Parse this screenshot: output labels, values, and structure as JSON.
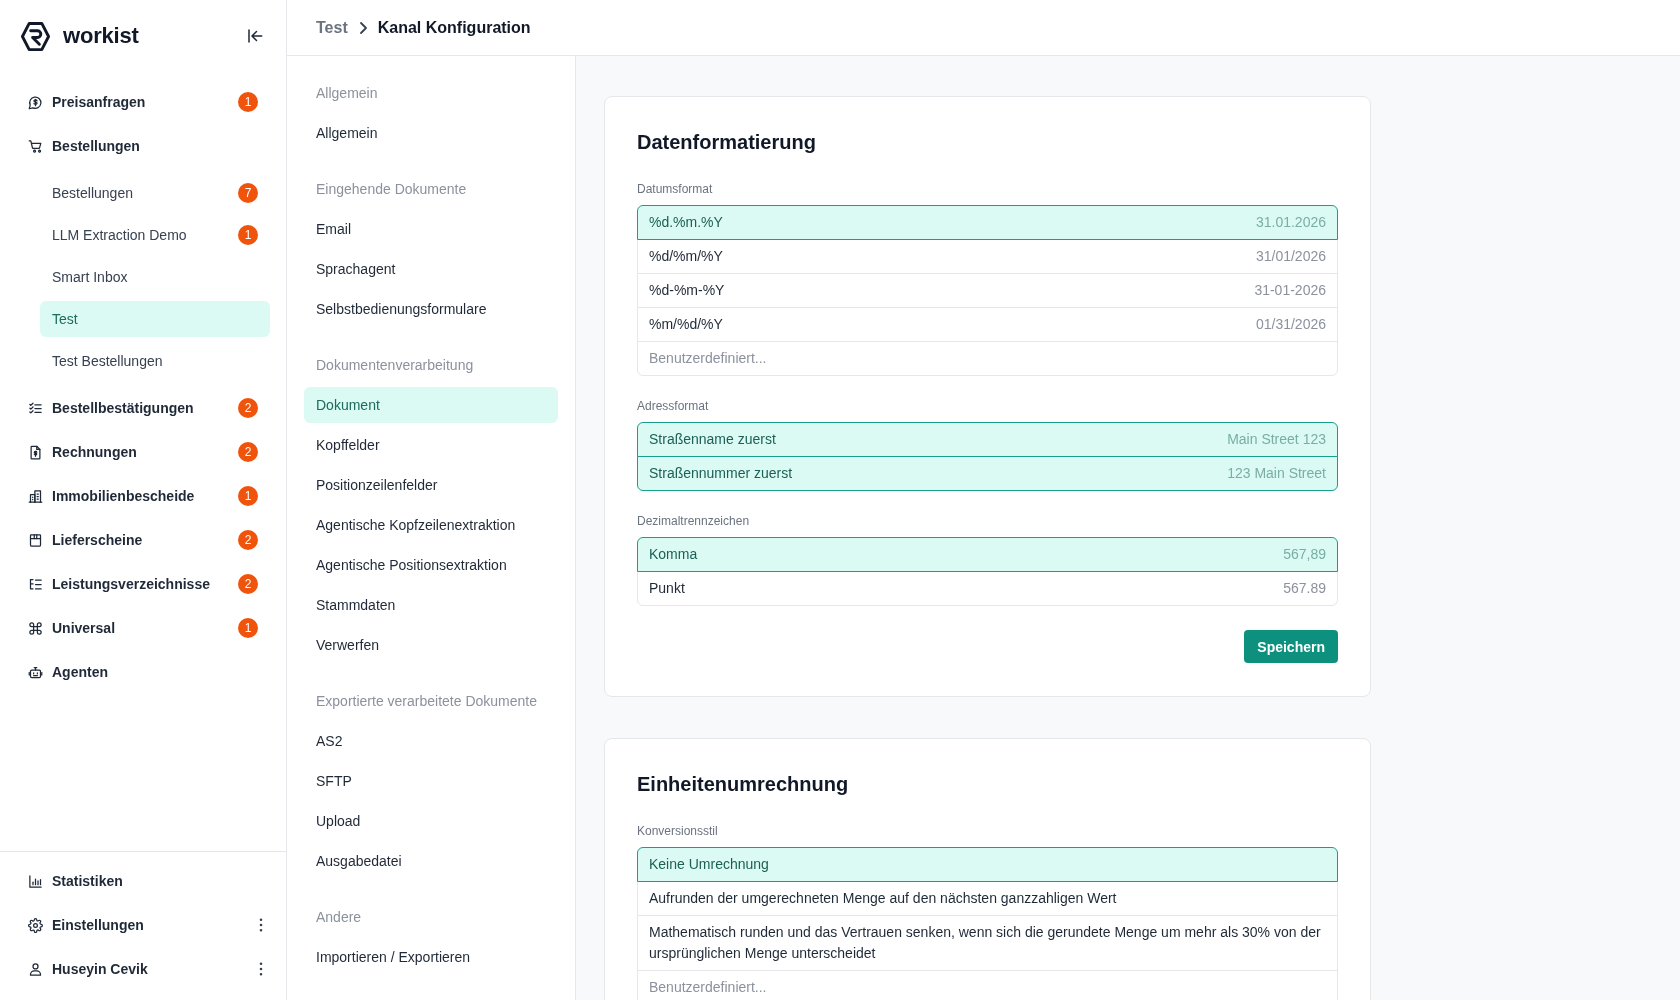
{
  "sidebar": {
    "brand": "workist",
    "items": [
      {
        "label": "Preisanfragen",
        "badge": "1",
        "selected": false
      },
      {
        "label": "Bestellungen",
        "selected": false,
        "children": [
          {
            "label": "Bestellungen",
            "badge": "7",
            "selected": false
          },
          {
            "label": "LLM Extraction Demo",
            "badge": "1",
            "selected": false
          },
          {
            "label": "Smart Inbox",
            "selected": false
          },
          {
            "label": "Test",
            "selected": true
          },
          {
            "label": "Test Bestellungen",
            "selected": false
          }
        ]
      },
      {
        "label": "Bestellbestätigungen",
        "badge": "2",
        "selected": false
      },
      {
        "label": "Rechnungen",
        "badge": "2",
        "selected": false
      },
      {
        "label": "Immobilienbescheide",
        "badge": "1",
        "selected": false
      },
      {
        "label": "Lieferscheine",
        "badge": "2",
        "selected": false
      },
      {
        "label": "Leistungsverzeichnisse",
        "badge": "2",
        "selected": false
      },
      {
        "label": "Universal",
        "badge": "1",
        "selected": false
      },
      {
        "label": "Agenten",
        "selected": false
      }
    ],
    "footer_items": [
      {
        "label": "Statistiken",
        "has_menu": false,
        "selected": false
      },
      {
        "label": "Einstellungen",
        "has_menu": true,
        "selected": false
      },
      {
        "label": "Huseyin Cevik",
        "has_menu": true,
        "selected": false
      }
    ]
  },
  "breadcrumb": [
    "Test",
    "Kanal Konfiguration"
  ],
  "settings_nav": {
    "sections": [
      {
        "title": "Allgemein",
        "items": [
          {
            "label": "Allgemein",
            "selected": false
          }
        ]
      },
      {
        "title": "Eingehende Dokumente",
        "items": [
          {
            "label": "Email",
            "selected": false
          },
          {
            "label": "Sprachagent",
            "selected": false
          },
          {
            "label": "Selbstbedienungsformulare",
            "selected": false
          }
        ]
      },
      {
        "title": "Dokumentenverarbeitung",
        "items": [
          {
            "label": "Dokument",
            "selected": true
          },
          {
            "label": "Kopffelder",
            "selected": false
          },
          {
            "label": "Positionzeilenfelder",
            "selected": false
          },
          {
            "label": "Agentische Kopfzeilenextraktion",
            "selected": false
          },
          {
            "label": "Agentische Positionsextraktion",
            "selected": false
          },
          {
            "label": "Stammdaten",
            "selected": false
          },
          {
            "label": "Verwerfen",
            "selected": false
          }
        ]
      },
      {
        "title": "Exportierte verarbeitete Dokumente",
        "items": [
          {
            "label": "AS2",
            "selected": false
          },
          {
            "label": "SFTP",
            "selected": false
          },
          {
            "label": "Upload",
            "selected": false
          },
          {
            "label": "Ausgabedatei",
            "selected": false
          }
        ]
      },
      {
        "title": "Andere",
        "items": [
          {
            "label": "Importieren / Exportieren",
            "selected": false
          }
        ]
      }
    ]
  },
  "cards": [
    {
      "title": "Datenformatierung",
      "fields": [
        {
          "label": "Datumsformat",
          "options": [
            {
              "label": "%d.%m.%Y",
              "example": "31.01.2026",
              "selected": true
            },
            {
              "label": "%d/%m/%Y",
              "example": "31/01/2026",
              "selected": false
            },
            {
              "label": "%d-%m-%Y",
              "example": "31-01-2026",
              "selected": false
            },
            {
              "label": "%m/%d/%Y",
              "example": "01/31/2026",
              "selected": false
            }
          ],
          "custom": {
            "placeholder": "Benutzerdefiniert..."
          }
        },
        {
          "label": "Adressformat",
          "options": [
            {
              "label": "Straßenname zuerst",
              "example": "Main Street 123",
              "selected": true
            },
            {
              "label": "Straßennummer zuerst",
              "example": "123 Main Street",
              "selected": true
            }
          ]
        },
        {
          "label": "Dezimaltrennzeichen",
          "options": [
            {
              "label": "Komma",
              "example": "567,89",
              "selected": true
            },
            {
              "label": "Punkt",
              "example": "567.89",
              "selected": false
            }
          ]
        }
      ],
      "button": "Speichern"
    },
    {
      "title": "Einheitenumrechnung",
      "fields": [
        {
          "label": "Konversionsstil",
          "options": [
            {
              "label": "Keine Umrechnung",
              "selected": true
            },
            {
              "label": "Aufrunden der umgerechneten Menge auf den nächsten ganzzahligen Wert",
              "selected": false
            },
            {
              "label": "Mathematisch runden und das Vertrauen senken, wenn sich die gerundete Menge um mehr als 30% von der ursprünglichen Menge unterscheidet",
              "selected": false
            }
          ],
          "custom": {
            "placeholder": "Benutzerdefiniert..."
          }
        }
      ]
    }
  ]
}
